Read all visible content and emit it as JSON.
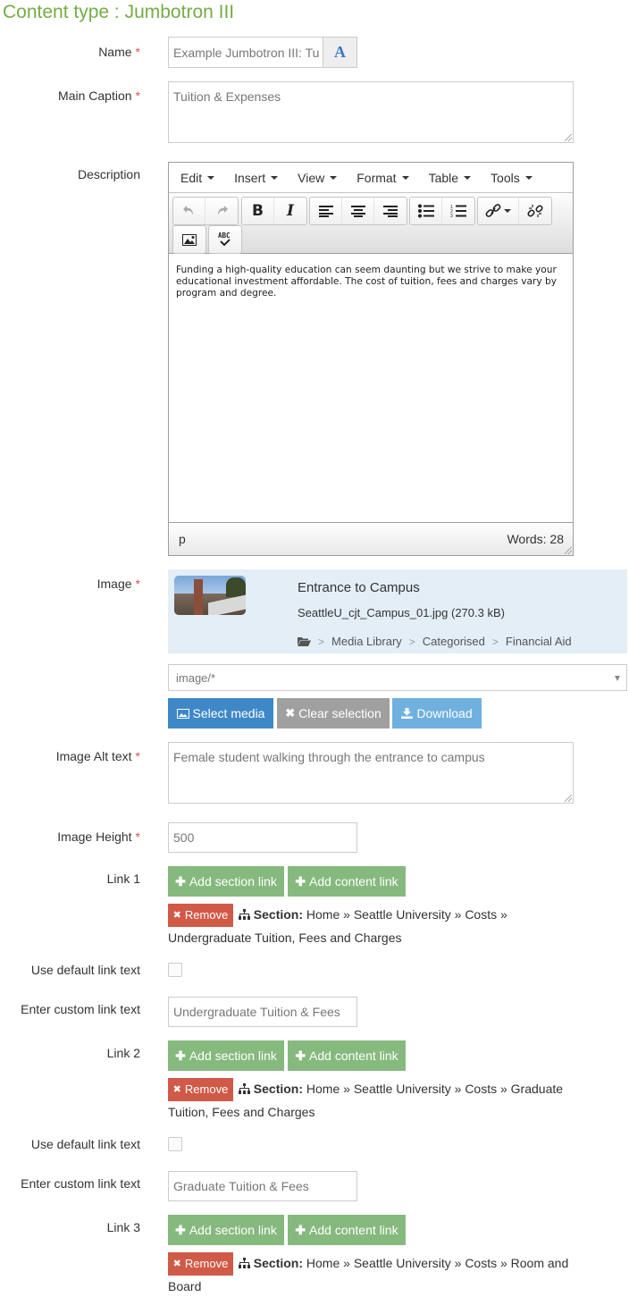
{
  "page": {
    "title": "Content type : Jumbotron III"
  },
  "name": {
    "label": "Name",
    "value": "Example Jumbotron III: Tu",
    "addon_icon": "font-A-icon"
  },
  "main_caption": {
    "label": "Main Caption",
    "value": "Tuition & Expenses"
  },
  "description": {
    "label": "Description",
    "menu": [
      "Edit",
      "Insert",
      "View",
      "Format",
      "Table",
      "Tools"
    ],
    "toolbar_icons": [
      "undo-icon",
      "redo-icon",
      "bold-icon",
      "italic-icon",
      "align-left-icon",
      "align-center-icon",
      "align-right-icon",
      "bullet-list-icon",
      "numbered-list-icon",
      "link-icon",
      "unlink-icon",
      "image-icon",
      "spellcheck-icon"
    ],
    "content": "Funding a high-quality education can seem daunting but we strive to make your educational investment affordable. The cost of tuition, fees and charges vary by program and degree.",
    "path": "p",
    "word_count": "Words: 28"
  },
  "image": {
    "label": "Image",
    "title": "Entrance to Campus",
    "file": "SeattleU_cjt_Campus_01.jpg (270.3 kB)",
    "path": [
      "Media Library",
      "Categorised",
      "Financial Aid"
    ],
    "filter": "image/*",
    "buttons": {
      "select": "Select media",
      "clear": "Clear selection",
      "download": "Download"
    }
  },
  "image_alt": {
    "label": "Image Alt text",
    "value": "Female student walking through the entrance to campus"
  },
  "image_height": {
    "label": "Image Height",
    "value": "500"
  },
  "links": [
    {
      "label": "Link 1",
      "add_section": "Add section link",
      "add_content": "Add content link",
      "remove": "Remove",
      "section_label": "Section:",
      "section_path": "Home » Seattle University » Costs » Undergraduate Tuition, Fees and Charges",
      "default_label": "Use default link text",
      "default_checked": false,
      "custom_label": "Enter custom link text",
      "custom_value": "Undergraduate Tuition & Fees"
    },
    {
      "label": "Link 2",
      "add_section": "Add section link",
      "add_content": "Add content link",
      "remove": "Remove",
      "section_label": "Section:",
      "section_path": "Home » Seattle University » Costs » Graduate Tuition, Fees and Charges",
      "default_label": "Use default link text",
      "default_checked": false,
      "custom_label": "Enter custom link text",
      "custom_value": "Graduate Tuition & Fees"
    },
    {
      "label": "Link 3",
      "add_section": "Add section link",
      "add_content": "Add content link",
      "remove": "Remove",
      "section_label": "Section:",
      "section_path": "Home » Seattle University » Costs » Room and Board"
    }
  ],
  "required_marker": "*"
}
